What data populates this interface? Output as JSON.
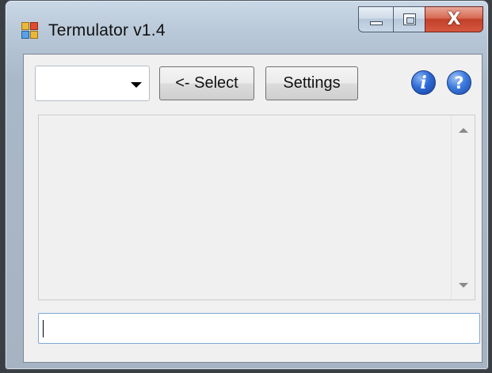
{
  "window": {
    "title": "Termulator v1.4",
    "close_glyph": "X",
    "icons": {
      "app": "app-icon",
      "minimize": "minimize-icon",
      "maximize": "maximize-icon",
      "close": "close-icon"
    }
  },
  "toolbar": {
    "port_combo": {
      "value": ""
    },
    "select_label": "<- Select",
    "settings_label": "Settings",
    "info_glyph": "i",
    "help_glyph": "?"
  },
  "output": {
    "text": ""
  },
  "command_input": {
    "value": ""
  },
  "colors": {
    "close_button": "#c2402a",
    "info_icon": "#2d6ad6",
    "client_bg": "#f0f0f0"
  }
}
